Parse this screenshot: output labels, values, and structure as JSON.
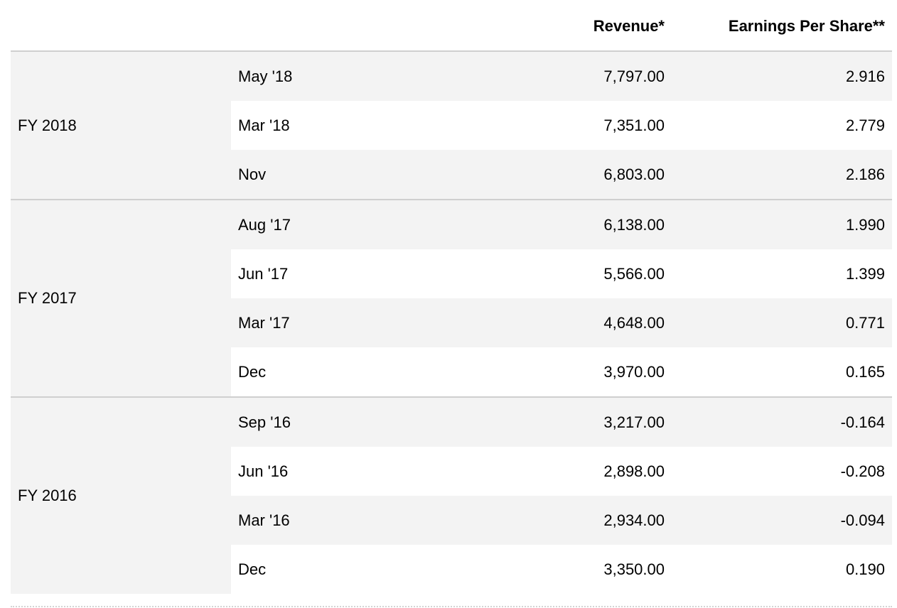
{
  "header": {
    "revenue": "Revenue*",
    "eps": "Earnings Per Share**"
  },
  "groups": [
    {
      "year": "FY 2018",
      "rows": [
        {
          "period": "May '18",
          "revenue": "7,797.00",
          "eps": "2.916"
        },
        {
          "period": "Mar '18",
          "revenue": "7,351.00",
          "eps": "2.779"
        },
        {
          "period": "Nov",
          "revenue": "6,803.00",
          "eps": "2.186"
        }
      ]
    },
    {
      "year": "FY 2017",
      "rows": [
        {
          "period": "Aug '17",
          "revenue": "6,138.00",
          "eps": "1.990"
        },
        {
          "period": "Jun '17",
          "revenue": "5,566.00",
          "eps": "1.399"
        },
        {
          "period": "Mar '17",
          "revenue": "4,648.00",
          "eps": "0.771"
        },
        {
          "period": "Dec",
          "revenue": "3,970.00",
          "eps": "0.165"
        }
      ]
    },
    {
      "year": "FY 2016",
      "rows": [
        {
          "period": "Sep '16",
          "revenue": "3,217.00",
          "eps": "-0.164"
        },
        {
          "period": "Jun '16",
          "revenue": "2,898.00",
          "eps": "-0.208"
        },
        {
          "period": "Mar '16",
          "revenue": "2,934.00",
          "eps": "-0.094"
        },
        {
          "period": "Dec",
          "revenue": "3,350.00",
          "eps": "0.190"
        }
      ]
    }
  ]
}
